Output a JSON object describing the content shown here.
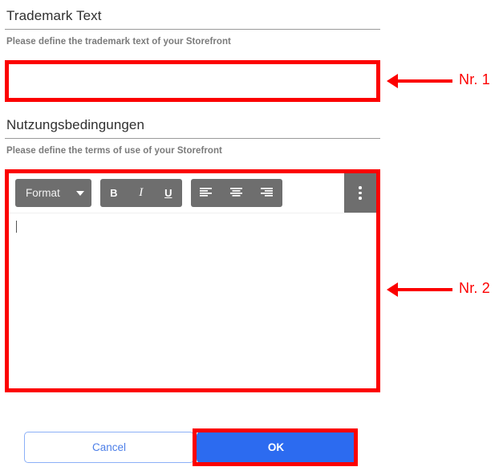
{
  "sections": [
    {
      "title": "Trademark Text",
      "description": "Please define the trademark text of your Storefront",
      "input": {
        "value": "",
        "placeholder": ""
      }
    },
    {
      "title": "Nutzungsbedingungen",
      "description": "Please define the terms of use of your Storefront",
      "editor": {
        "toolbar": {
          "format_label": "Format",
          "bold_label": "B",
          "italic_label": "I",
          "underline_label": "U",
          "align_left_icon": "align-left-icon",
          "align_center_icon": "align-center-icon",
          "align_right_icon": "align-right-icon",
          "overflow_icon": "kebab-menu-icon",
          "dropdown_icon": "chevron-down-icon"
        },
        "content": ""
      }
    }
  ],
  "footer": {
    "cancel_label": "Cancel",
    "ok_label": "OK"
  },
  "annotations": [
    {
      "label": "Nr. 1",
      "icon": "arrow-left-icon"
    },
    {
      "label": "Nr. 2",
      "icon": "arrow-left-icon"
    }
  ],
  "colors": {
    "annotation_red": "#fc0000",
    "primary_blue": "#2c6bf0",
    "toolbar_gray": "#6e6e6e",
    "heading_text": "#303030",
    "description_text": "#7b7b7b"
  }
}
